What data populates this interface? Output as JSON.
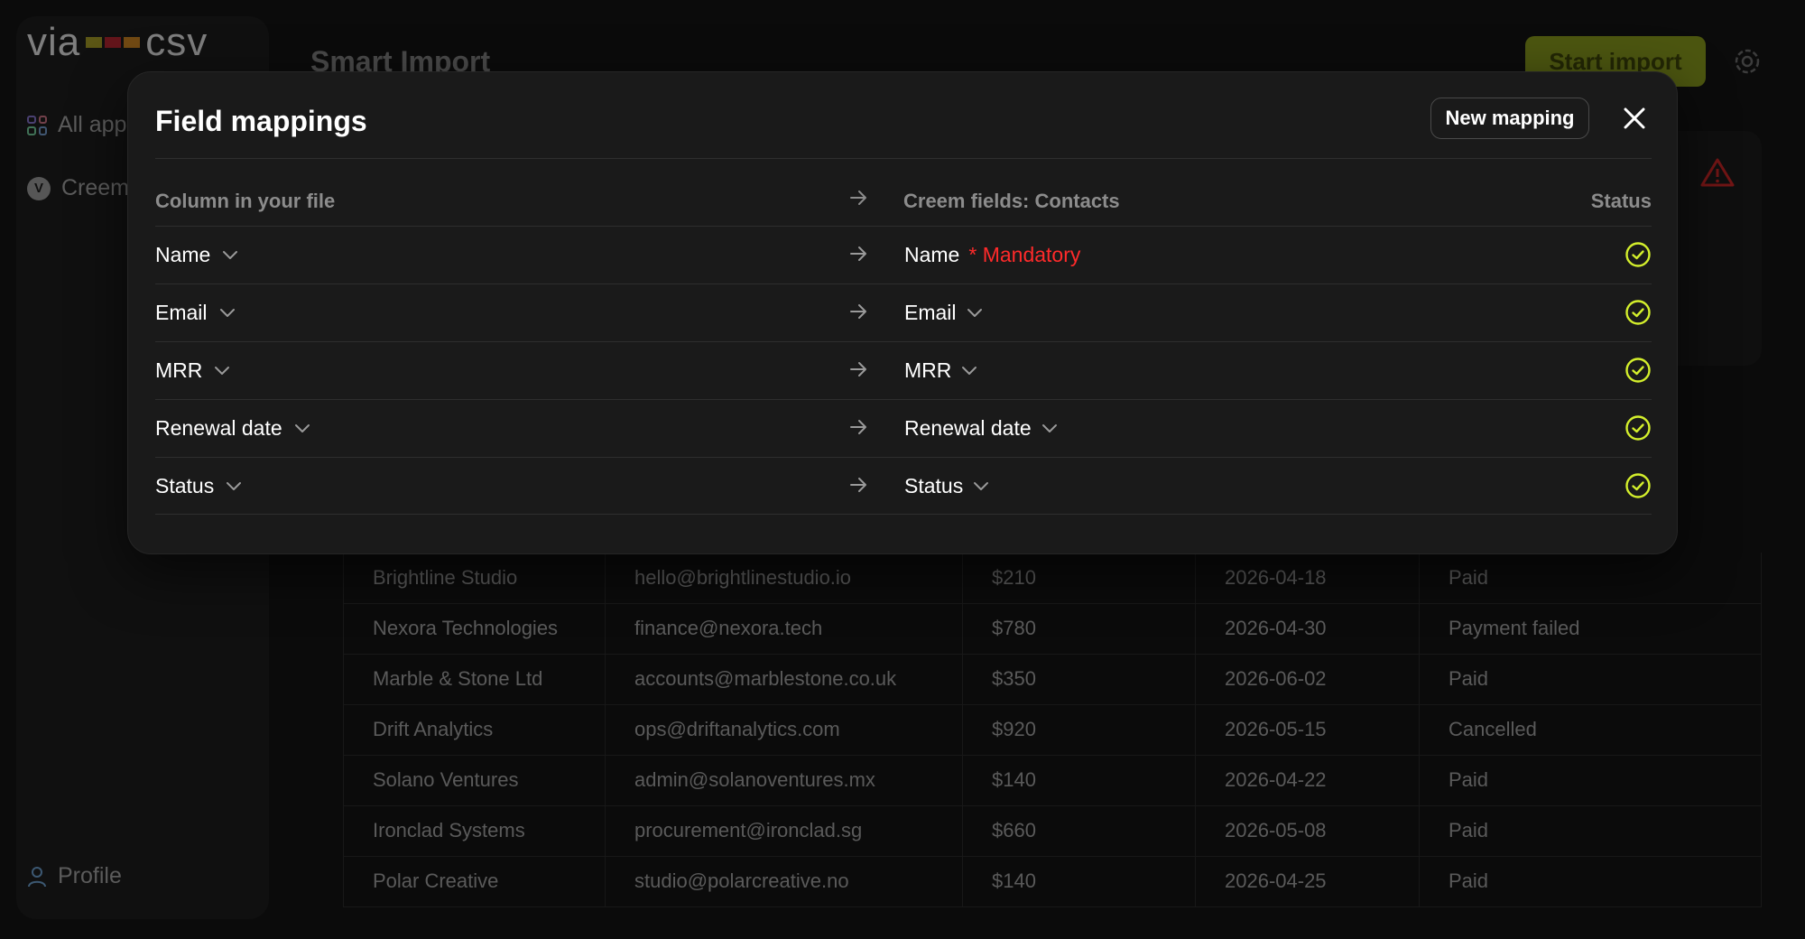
{
  "app": {
    "logo_text_left": "via",
    "logo_text_right": "csv",
    "page_title": "Smart Import",
    "start_import_label": "Start import"
  },
  "sidebar": {
    "items": [
      {
        "label": "All apps",
        "icon": "grid-icon"
      },
      {
        "label": "Creem",
        "icon": "creem-logo-icon"
      }
    ],
    "profile_label": "Profile"
  },
  "table": {
    "rows": [
      [
        "Brightline Studio",
        "hello@brightlinestudio.io",
        "$210",
        "2026-04-18",
        "Paid"
      ],
      [
        "Nexora Technologies",
        "finance@nexora.tech",
        "$780",
        "2026-04-30",
        "Payment failed"
      ],
      [
        "Marble & Stone Ltd",
        "accounts@marblestone.co.uk",
        "$350",
        "2026-06-02",
        "Paid"
      ],
      [
        "Drift Analytics",
        "ops@driftanalytics.com",
        "$920",
        "2026-05-15",
        "Cancelled"
      ],
      [
        "Solano Ventures",
        "admin@solanoventures.mx",
        "$140",
        "2026-04-22",
        "Paid"
      ],
      [
        "Ironclad Systems",
        "procurement@ironclad.sg",
        "$660",
        "2026-05-08",
        "Paid"
      ],
      [
        "Polar Creative",
        "studio@polarcreative.no",
        "$140",
        "2026-04-25",
        "Paid"
      ]
    ]
  },
  "modal": {
    "title": "Field mappings",
    "new_mapping_label": "New mapping",
    "header": {
      "source": "Column in your file",
      "target": "Creem fields: Contacts",
      "status": "Status"
    },
    "mandatory_label": "* Mandatory",
    "rows": [
      {
        "source": "Name",
        "target": "Name",
        "mandatory": true
      },
      {
        "source": "Email",
        "target": "Email",
        "mandatory": false
      },
      {
        "source": "MRR",
        "target": "MRR",
        "mandatory": false
      },
      {
        "source": "Renewal date",
        "target": "Renewal date",
        "mandatory": false
      },
      {
        "source": "Status",
        "target": "Status",
        "mandatory": false
      }
    ]
  },
  "colors": {
    "accent": "#d4ef2c",
    "mandatory": "#ff2a2a",
    "warning": "#e02424"
  }
}
